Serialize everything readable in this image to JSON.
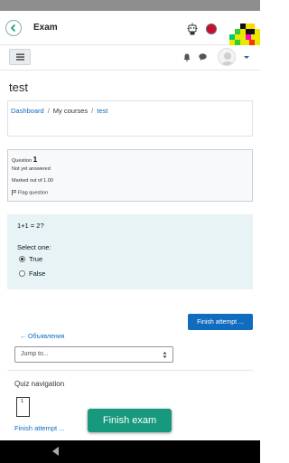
{
  "app": {
    "title": "Exam"
  },
  "page": {
    "title": "test"
  },
  "breadcrumb": {
    "items": [
      "Dashboard",
      "My courses",
      "test"
    ],
    "separator": "/"
  },
  "question_info": {
    "label": "Question",
    "number": "1",
    "status": "Not yet answered",
    "marks": "Marked out of 1.00",
    "flag_label": "Flag question"
  },
  "question": {
    "text": "1+1 = 2?",
    "prompt": "Select one:",
    "options": [
      {
        "label": "True",
        "selected": true
      },
      {
        "label": "False",
        "selected": false
      }
    ]
  },
  "actions": {
    "finish_attempt_top": "Finish attempt ...",
    "prev_link": "← Объявления",
    "jump_to": "Jump to...",
    "finish_attempt_bottom": "Finish attempt ...",
    "finish_exam": "Finish exam"
  },
  "quiz_navigation": {
    "title": "Quiz navigation",
    "buttons": [
      "1"
    ]
  },
  "colors": {
    "primary": "#0f6cbf",
    "accent_green": "#16997c",
    "question_bg": "#e7f3f5",
    "info_bg": "#f8f9fa"
  },
  "icons": [
    "back-arrow-icon",
    "robot-icon",
    "red-dot-icon",
    "menu-icon",
    "bell-icon",
    "chat-icon",
    "avatar-icon",
    "caret-down-icon",
    "flag-icon",
    "up-down-icon",
    "system-back-icon"
  ]
}
